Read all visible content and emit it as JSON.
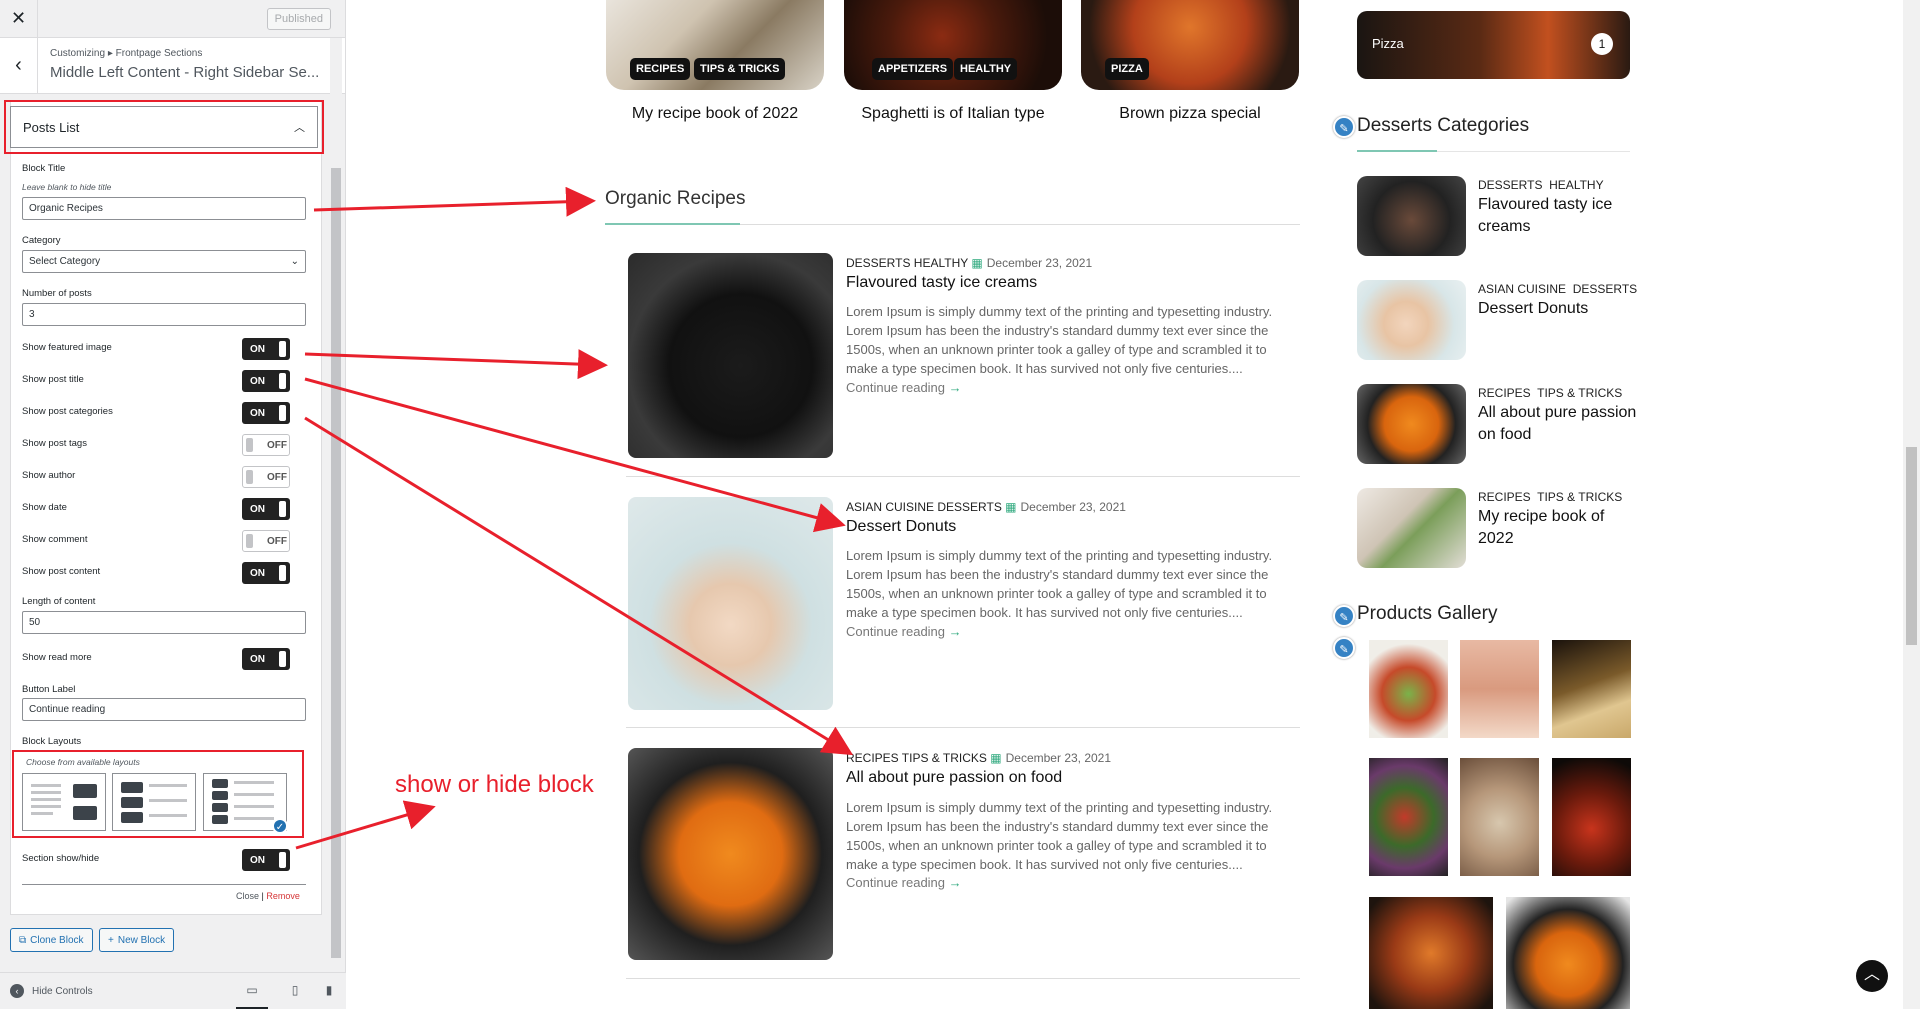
{
  "customizer": {
    "published_label": "Published",
    "breadcrumb_root": "Customizing",
    "breadcrumb_sep": "▸",
    "breadcrumb_section": "Frontpage Sections",
    "section_title": "Middle Left Content - Right Sidebar Se...",
    "block_name": "Posts List",
    "fields": {
      "block_title_label": "Block Title",
      "block_title_desc": "Leave blank to hide title",
      "block_title_value": "Organic Recipes",
      "category_label": "Category",
      "category_value": "Select Category",
      "num_posts_label": "Number of posts",
      "num_posts_value": "3",
      "length_label": "Length of content",
      "length_value": "50",
      "button_label_label": "Button Label",
      "button_label_value": "Continue reading",
      "layouts_label": "Block Layouts",
      "layouts_desc": "Choose from available layouts",
      "section_show_label": "Section show/hide"
    },
    "toggles": [
      {
        "label": "Show featured image",
        "state": "ON"
      },
      {
        "label": "Show post title",
        "state": "ON"
      },
      {
        "label": "Show post categories",
        "state": "ON"
      },
      {
        "label": "Show post tags",
        "state": "OFF"
      },
      {
        "label": "Show author",
        "state": "OFF"
      },
      {
        "label": "Show date",
        "state": "ON"
      },
      {
        "label": "Show comment",
        "state": "OFF"
      },
      {
        "label": "Show post content",
        "state": "ON"
      }
    ],
    "show_read_more": {
      "label": "Show read more",
      "state": "ON"
    },
    "section_show_state": "ON",
    "close_label": "Close",
    "remove_label": "Remove",
    "clone_label": "Clone Block",
    "new_label": "New Block",
    "hide_controls_label": "Hide Controls"
  },
  "annotation": {
    "text": "show or hide block",
    "color": "#e8202c"
  },
  "top_cards": [
    {
      "title": "My recipe book of 2022",
      "tags": [
        "RECIPES",
        "TIPS & TRICKS"
      ]
    },
    {
      "title": "Spaghetti is of Italian type",
      "tags": [
        "APPETIZERS",
        "HEALTHY"
      ]
    },
    {
      "title": "Brown pizza special",
      "tags": [
        "PIZZA"
      ]
    }
  ],
  "section_title": "Organic Recipes",
  "posts": [
    {
      "categories": "DESSERTS HEALTHY",
      "date": "December 23, 2021",
      "title": "Flavoured tasty ice creams",
      "excerpt": "Lorem Ipsum is simply dummy text of the printing and typesetting industry. Lorem Ipsum has been the industry's standard dummy text ever since the 1500s, when an unknown printer took a galley of type and scrambled it to make a type specimen book. It has survived not only five centuries....",
      "read_more": "Continue reading"
    },
    {
      "categories": "ASIAN CUISINE DESSERTS",
      "date": "December 23, 2021",
      "title": "Dessert Donuts",
      "excerpt": "Lorem Ipsum is simply dummy text of the printing and typesetting industry. Lorem Ipsum has been the industry's standard dummy text ever since the 1500s, when an unknown printer took a galley of type and scrambled it to make a type specimen book. It has survived not only five centuries....",
      "read_more": "Continue reading"
    },
    {
      "categories": "RECIPES TIPS & TRICKS",
      "date": "December 23, 2021",
      "title": "All about pure passion on food",
      "excerpt": "Lorem Ipsum is simply dummy text of the printing and typesetting industry. Lorem Ipsum has been the industry's standard dummy text ever since the 1500s, when an unknown printer took a galley of type and scrambled it to make a type specimen book. It has survived not only five centuries....",
      "read_more": "Continue reading"
    }
  ],
  "sidebar": {
    "pizza_label": "Pizza",
    "pizza_count": "1",
    "desserts_title": "Desserts Categories",
    "desserts_items": [
      {
        "cat1": "DESSERTS",
        "cat2": "HEALTHY",
        "title": "Flavoured tasty ice creams"
      },
      {
        "cat1": "ASIAN CUISINE",
        "cat2": "DESSERTS",
        "title": "Dessert Donuts"
      },
      {
        "cat1": "RECIPES",
        "cat2": "TIPS & TRICKS",
        "title": "All about pure passion on food"
      },
      {
        "cat1": "RECIPES",
        "cat2": "TIPS & TRICKS",
        "title": "My recipe book of 2022"
      }
    ],
    "gallery_title": "Products Gallery"
  },
  "colors": {
    "accent": "#7fc7b3",
    "annotation_red": "#e8202c",
    "link_green": "#2fa97e",
    "edit_blue": "#3582c4"
  }
}
